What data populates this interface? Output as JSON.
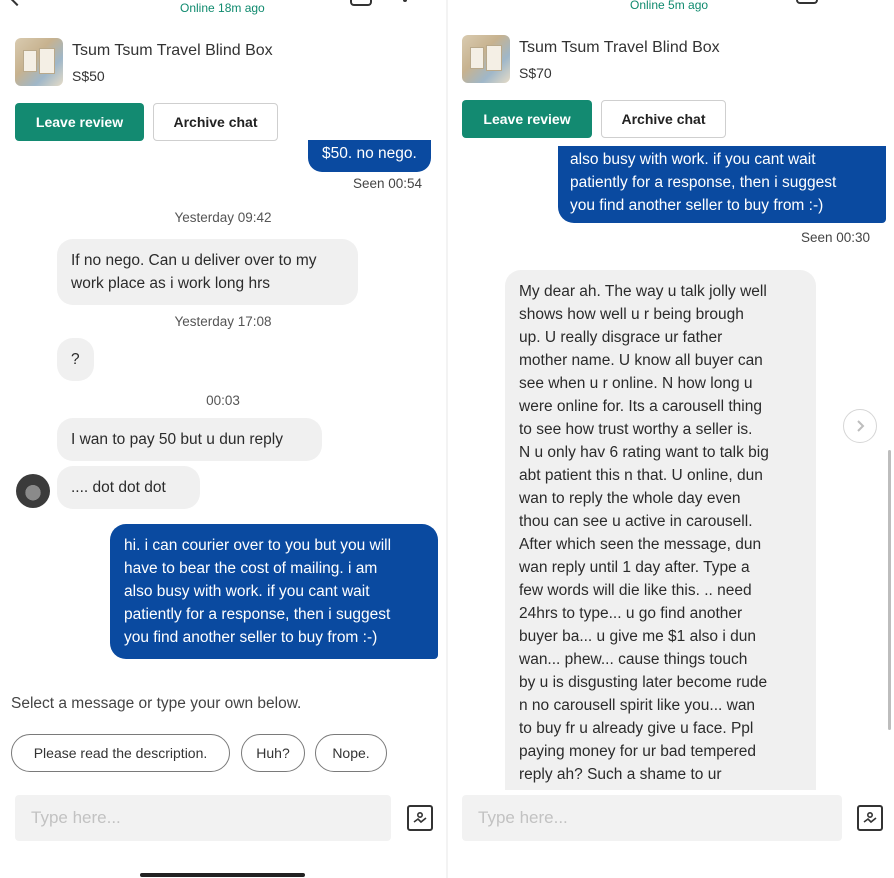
{
  "left": {
    "online_status": "Online 18m ago",
    "product": {
      "title": "Tsum Tsum Travel Blind Box",
      "price": "S$50"
    },
    "actions": {
      "leave_review": "Leave review",
      "archive_chat": "Archive chat"
    },
    "messages": {
      "top_out": "$50. no nego.",
      "seen1": "Seen 00:54",
      "ts1": "Yesterday 09:42",
      "in1": [
        "If no nego. Can u deliver over to my",
        "work place as i work long hrs"
      ],
      "ts2": "Yesterday 17:08",
      "in2": "?",
      "ts3": "00:03",
      "in3": "I wan to pay 50 but u dun reply",
      "in4": ".... dot dot dot",
      "out1": [
        "hi. i can courier over to you but you will",
        "have to bear the cost of mailing. i am",
        "also busy with work. if you cant wait",
        "patiently for a response, then i suggest",
        "you find another seller to buy from :-)"
      ]
    },
    "quick_reply": {
      "label": "Select a message or type your own below.",
      "options": [
        "Please read the description.",
        "Huh?",
        "Nope."
      ]
    },
    "composer": {
      "placeholder": "Type here..."
    }
  },
  "right": {
    "online_status": "Online 5m ago",
    "product": {
      "title": "Tsum Tsum Travel Blind Box",
      "price": "S$70"
    },
    "actions": {
      "leave_review": "Leave review",
      "archive_chat": "Archive chat"
    },
    "messages": {
      "out1": [
        "also busy with work. if you cant wait",
        "patiently for a response, then i suggest",
        "you find another seller to buy from :-)"
      ],
      "seen1": "Seen 00:30",
      "in1": [
        "My dear ah. The way u talk jolly well",
        "shows how well u r being brough",
        "up. U really disgrace ur father",
        "mother name. U know all buyer can",
        "see when u r online. N how long u",
        "were online for. Its a carousell thing",
        "to see how trust worthy a seller is.",
        "N u only hav 6 rating want to talk big",
        "abt patient this n that. U online, dun",
        "wan to reply the whole day even",
        "thou can see u active in carousell.",
        "After which seen the message, dun",
        "wan reply until 1 day after. Type a",
        "few words will die like this. .. need",
        "24hrs to type... u go find another",
        "buyer ba... u give me $1 also i dun",
        "wan... phew... cause things touch",
        "by u is disgusting later become rude",
        "n no carousell spirit like you... wan",
        "to buy fr u already give u face. Ppl",
        "paying money for ur bad tempered",
        "reply ah? Such a shame to ur"
      ]
    },
    "composer": {
      "placeholder": "Type here..."
    }
  },
  "colors": {
    "accent_green": "#138a71",
    "outgoing_bubble": "#0a4aa0",
    "incoming_bubble": "#f0f0f0"
  },
  "icons": [
    "back-chevron-icon",
    "more-options-icon",
    "image-attach-icon",
    "next-arrow-icon",
    "avatar"
  ]
}
